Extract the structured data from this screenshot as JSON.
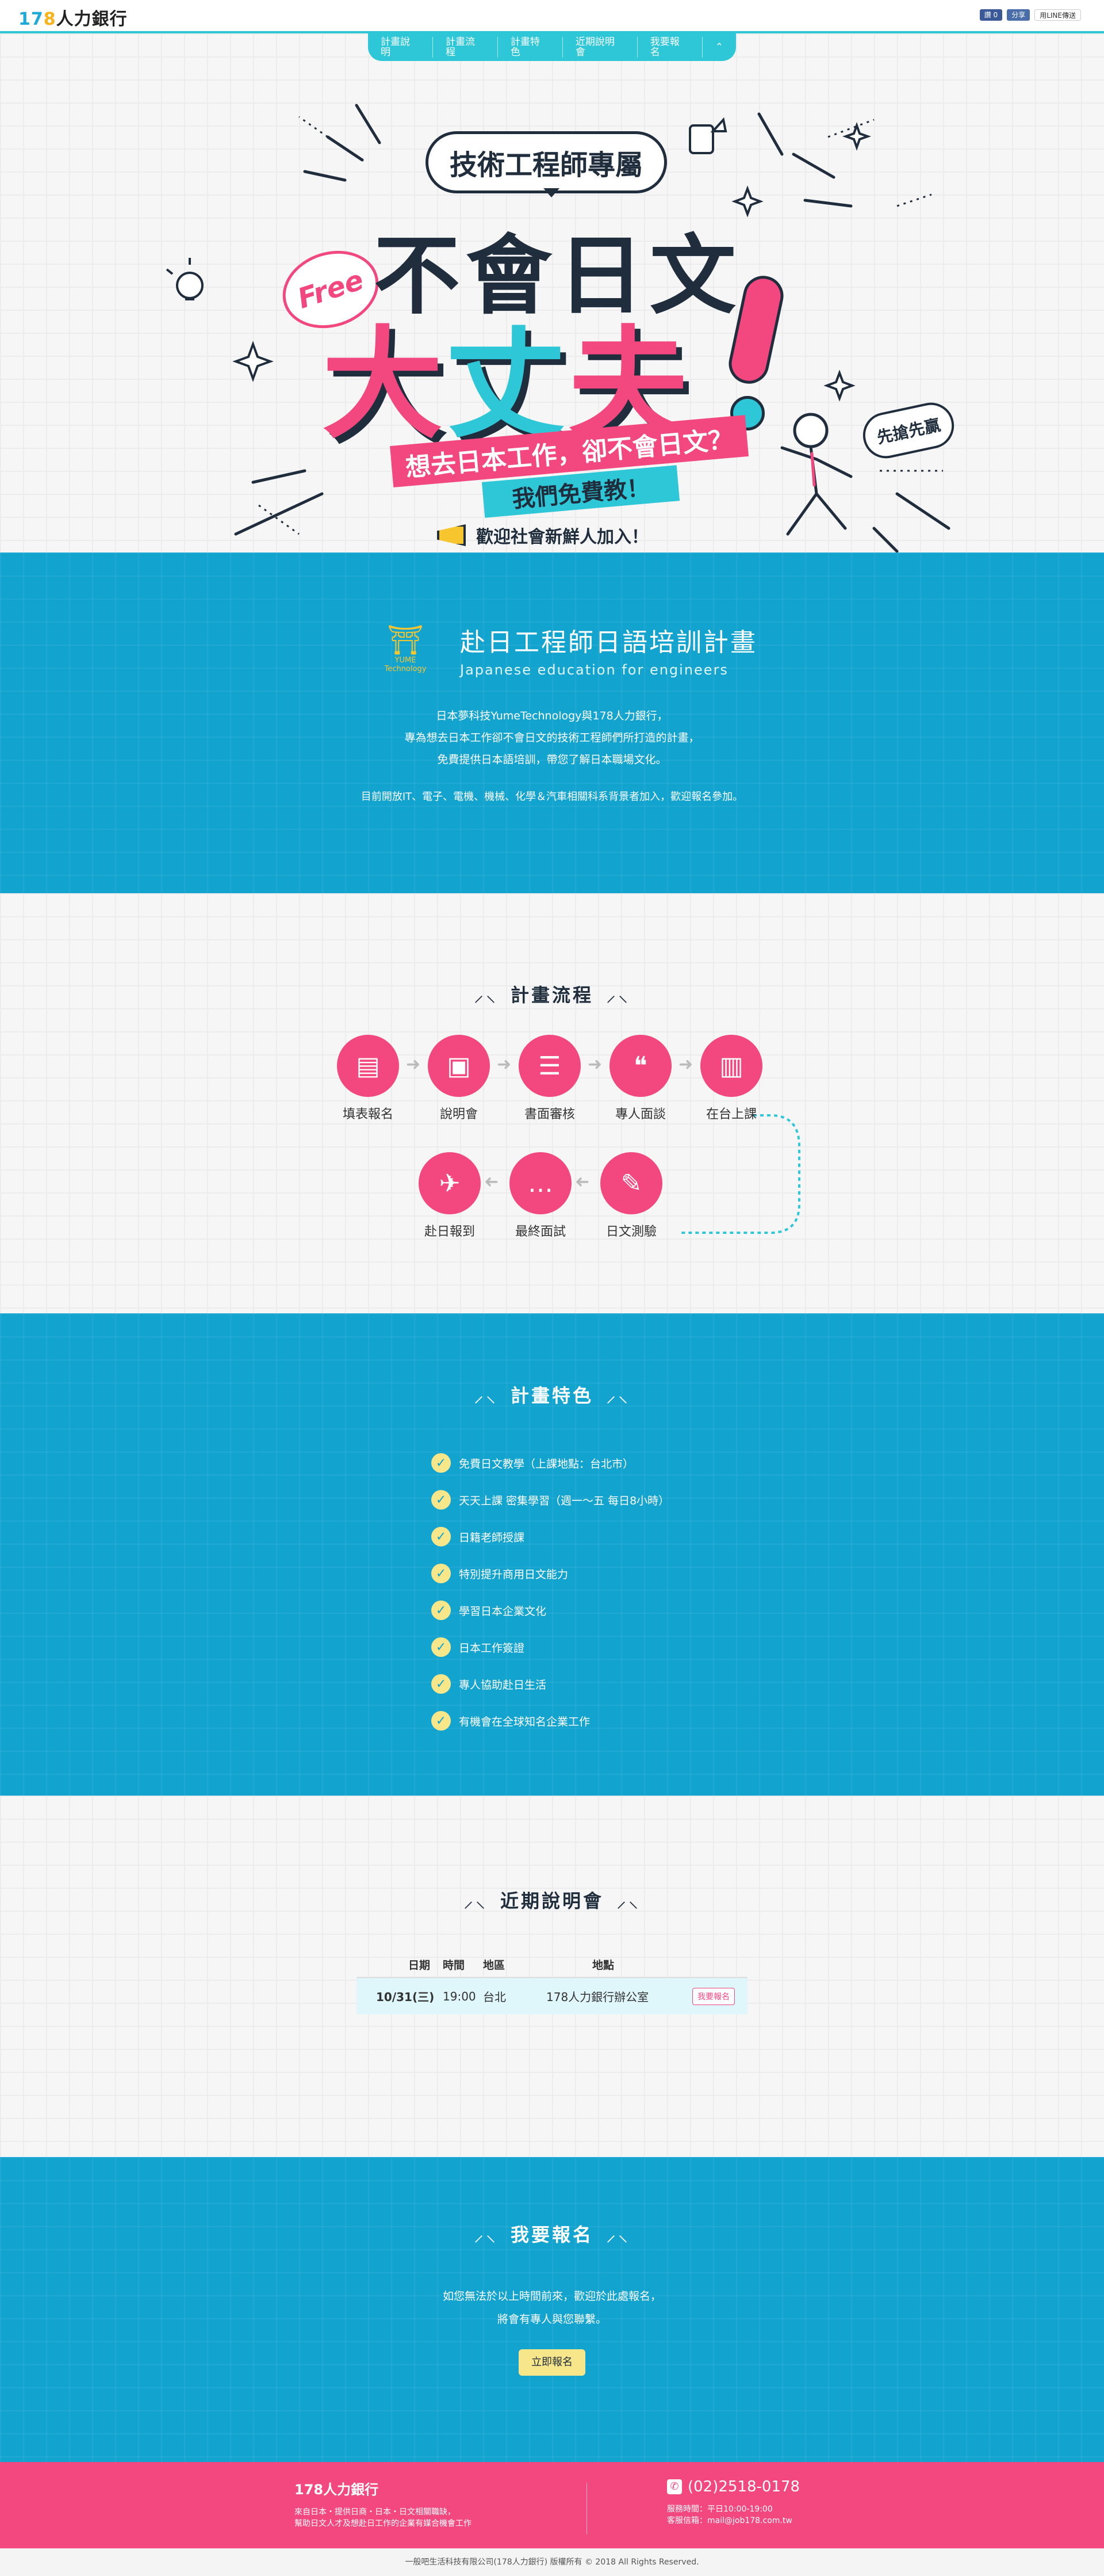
{
  "header": {
    "logo_num1": "17",
    "logo_num2": "8",
    "logo_text": "人力銀行",
    "fb_like": "讚 0",
    "fb_share": "分享",
    "line_share": "用LINE傳送"
  },
  "nav": {
    "items": [
      "計畫說明",
      "計畫流程",
      "計畫特色",
      "近期說明會",
      "我要報名",
      "⌃"
    ]
  },
  "hero": {
    "bubble": "技術工程師專屬",
    "free": "Free",
    "line1": "不會日文",
    "line2a": "大",
    "line2b": "丈",
    "line2c": "夫",
    "ribbon1": "想去日本工作，卻不會日文？",
    "ribbon2": "我們免費教！",
    "welcome": "歡迎社會新鮮人加入！",
    "first_win": "先搶先贏",
    "colors": {
      "pink": "#f2477f",
      "cyan": "#2ec7d8",
      "navy": "#1f2d3d",
      "yellow": "#f7c62f"
    }
  },
  "intro": {
    "logo_brand": "YUME Technology",
    "title_zh": "赴日工程師日語培訓計畫",
    "title_en": "Japanese education for engineers",
    "desc1": "日本夢科技YumeTechnology與178人力銀行，",
    "desc2": "專為想去日本工作卻不會日文的技術工程師們所打造的計畫，",
    "desc3": "免費提供日本語培訓，帶您了解日本職場文化。",
    "note": "目前開放IT、電子、電機、機械、化學＆汽車相關科系背景者加入，歡迎報名參加。"
  },
  "flow": {
    "title": "計畫流程",
    "steps_row1": [
      {
        "label": "填表報名",
        "icon": "document-icon"
      },
      {
        "label": "說明會",
        "icon": "presentation-icon"
      },
      {
        "label": "書面審核",
        "icon": "checklist-icon"
      },
      {
        "label": "專人面談",
        "icon": "chat-bubbles-icon"
      },
      {
        "label": "在台上課",
        "icon": "book-icon"
      }
    ],
    "steps_row2": [
      {
        "label": "赴日報到",
        "icon": "airplane-icon"
      },
      {
        "label": "最終面試",
        "icon": "speech-bubble-icon"
      },
      {
        "label": "日文測驗",
        "icon": "test-paper-icon"
      }
    ]
  },
  "features": {
    "title": "計畫特色",
    "items": [
      "免費日文教學（上課地點：台北市）",
      "天天上課 密集學習（週一～五 每日8小時）",
      "日籍老師授課",
      "特別提升商用日文能力",
      "學習日本企業文化",
      "日本工作簽證",
      "專人協助赴日生活",
      "有機會在全球知名企業工作"
    ]
  },
  "seminar": {
    "title": "近期說明會",
    "headers": [
      "日期",
      "時間",
      "地區",
      "地點"
    ],
    "rows": [
      {
        "date": "10/31(三)",
        "time": "19:00",
        "area": "台北",
        "place": "178人力銀行辦公室",
        "action": "我要報名"
      }
    ]
  },
  "signup": {
    "title": "我要報名",
    "desc1": "如您無法於以上時間前來，歡迎於此處報名，",
    "desc2": "將會有專人與您聯繫。",
    "button": "立即報名"
  },
  "footer": {
    "name": "178人力銀行",
    "desc1": "來自日本・提供日商・日本・日文相關職缺，",
    "desc2": "幫助日文人才及想赴日工作的企業有媒合機會工作",
    "phone": "(02)2518-0178",
    "service1": "服務時間：平日10:00-19:00",
    "service2": "客服信箱：mail@job178.com.tw",
    "copyright": "一般吧生活科技有限公司(178人力銀行) 版權所有 © 2018 All Rights Reserved."
  }
}
